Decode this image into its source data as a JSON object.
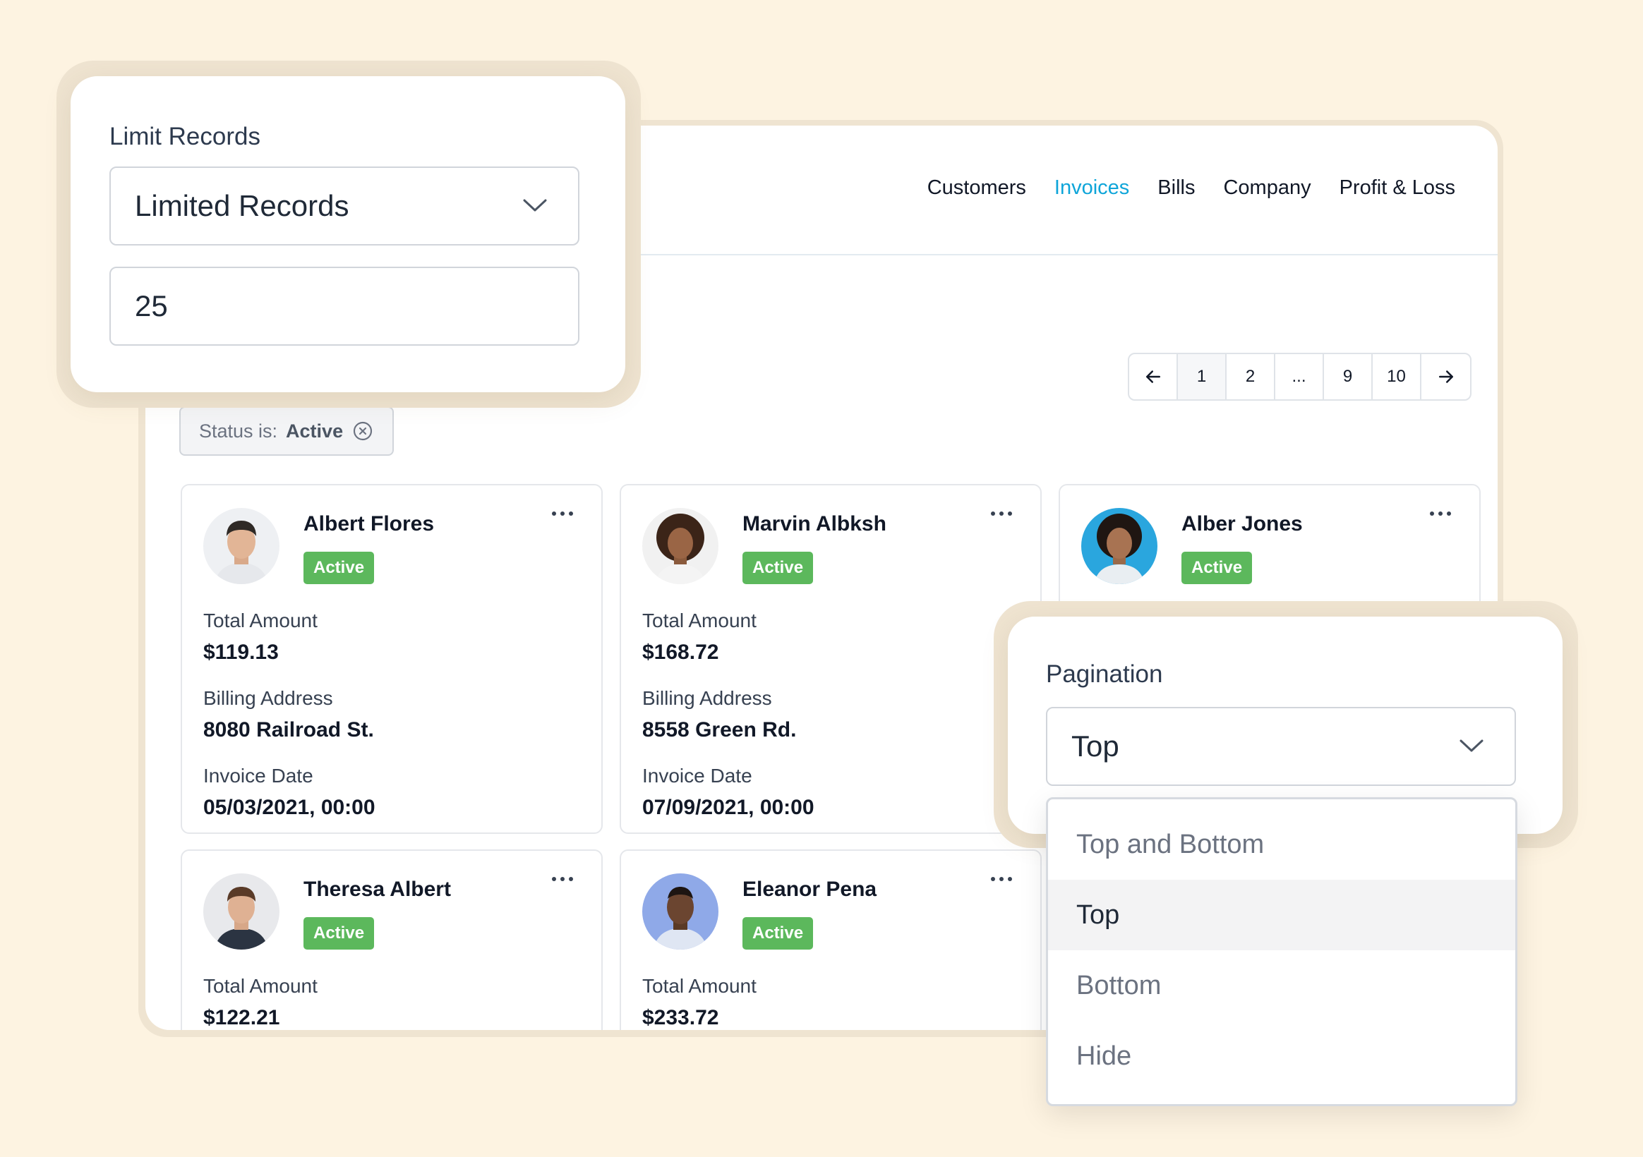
{
  "nav": {
    "items": [
      {
        "label": "Customers"
      },
      {
        "label": "Invoices"
      },
      {
        "label": "Bills"
      },
      {
        "label": "Company"
      },
      {
        "label": "Profit & Loss"
      }
    ],
    "active_color": "#0ea5d9"
  },
  "pagination": {
    "pages": [
      "1",
      "2",
      "...",
      "9",
      "10"
    ],
    "current": "1"
  },
  "filter": {
    "prefix": "Status is:",
    "value": "Active"
  },
  "cards": [
    {
      "name": "Albert Flores",
      "status": "Active",
      "amount_label": "Total Amount",
      "amount": "$119.13",
      "address_label": "Billing Address",
      "address": "8080 Railroad St.",
      "date_label": "Invoice Date",
      "date": "05/03/2021, 00:00"
    },
    {
      "name": "Marvin Albksh",
      "status": "Active",
      "amount_label": "Total Amount",
      "amount": "$168.72",
      "address_label": "Billing Address",
      "address": "8558 Green Rd.",
      "date_label": "Invoice Date",
      "date": "07/09/2021, 00:00"
    },
    {
      "name": "Alber Jones",
      "status": "Active"
    },
    {
      "name": "Theresa Albert",
      "status": "Active",
      "amount_label": "Total Amount",
      "amount": "$122.21"
    },
    {
      "name": "Eleanor Pena",
      "status": "Active",
      "amount_label": "Total Amount",
      "amount": "$233.72"
    }
  ],
  "limit_panel": {
    "label": "Limit Records",
    "select_value": "Limited Records",
    "input_value": "25"
  },
  "pagination_panel": {
    "label": "Pagination",
    "select_value": "Top",
    "options": [
      "Top and Bottom",
      "Top",
      "Bottom",
      "Hide"
    ],
    "selected": "Top"
  },
  "colors": {
    "background": "#fdf3e1",
    "badge": "#5cb85c",
    "frame": "#efe4d1"
  }
}
